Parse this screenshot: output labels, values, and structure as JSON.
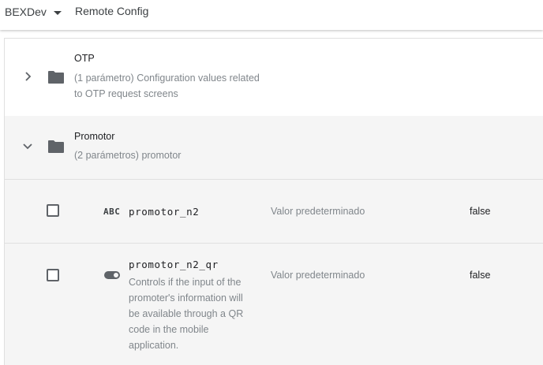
{
  "header": {
    "project": "BEXDev",
    "title": "Remote Config"
  },
  "groups": [
    {
      "name": "OTP",
      "desc": "(1 parámetro) Configuration values related to OTP request screens",
      "expanded": false
    },
    {
      "name": "Promotor",
      "desc": "(2 parámetros) promotor",
      "expanded": true
    }
  ],
  "parameters": [
    {
      "type_icon": "ABC",
      "type_icon_name": "string-type-icon",
      "name": "promotor_n2",
      "desc": "",
      "condition": "Valor predeterminado",
      "value": "false",
      "checked": false
    },
    {
      "type_icon": "",
      "type_icon_name": "boolean-toggle-icon",
      "name": "promotor_n2_qr",
      "desc": "Controls if the input of the promoter's information will be available through a QR code in the mobile application.",
      "condition": "Valor predeterminado",
      "value": "false",
      "checked": false
    }
  ],
  "colors": {
    "muted_text": "#80868b",
    "primary_text": "#202124",
    "group_expanded_bg": "#f5f5f5",
    "divider": "#e0e0e0"
  }
}
